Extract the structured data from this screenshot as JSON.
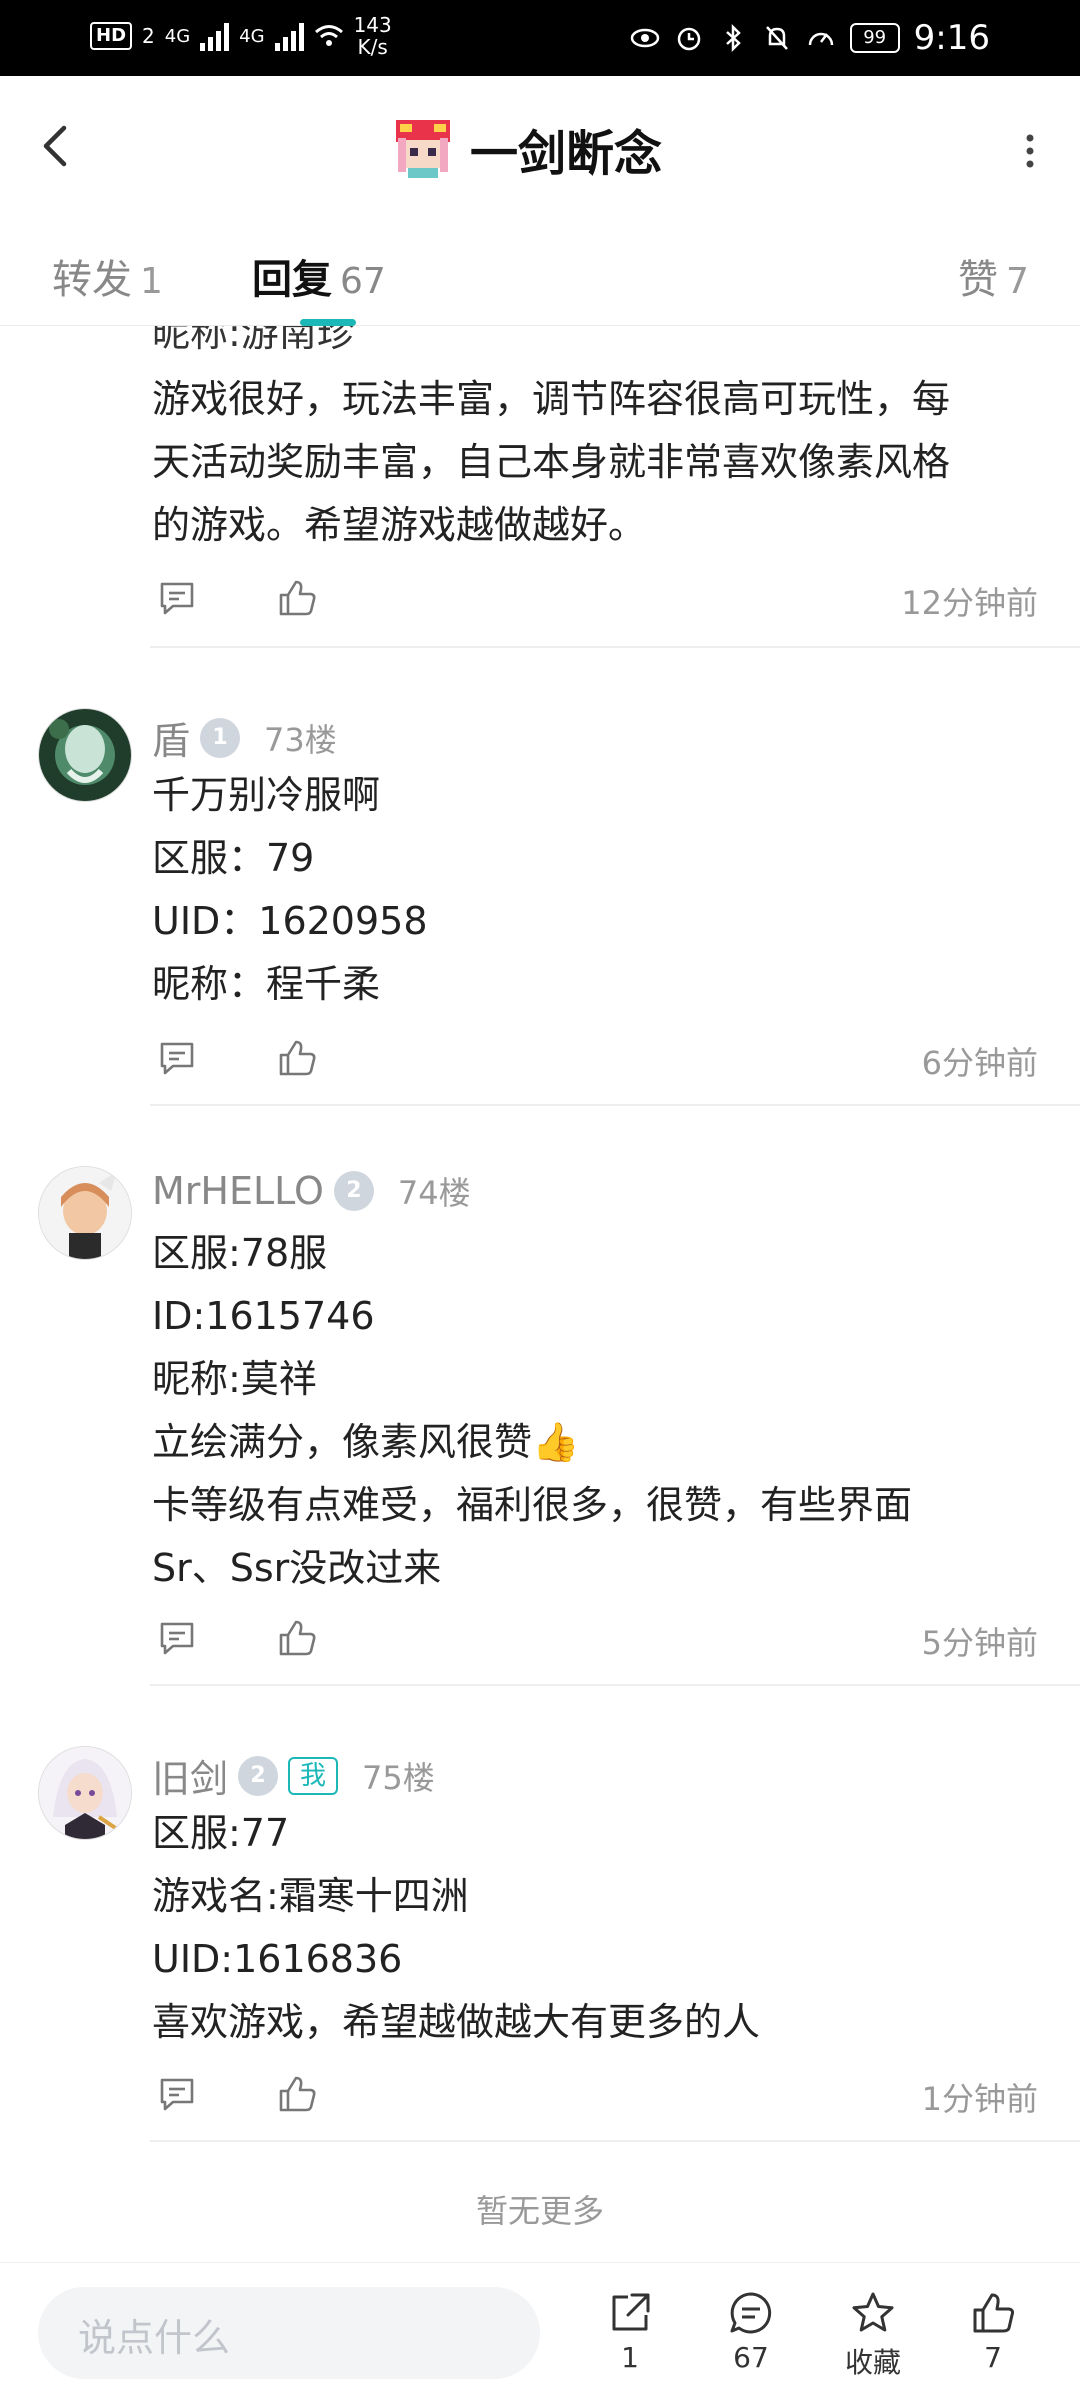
{
  "status": {
    "hd_label": "HD",
    "sim_label": "2",
    "net1": "4G",
    "net2": "4G",
    "speed_value": "143",
    "speed_unit": "K/s",
    "battery": "99",
    "time": "9:16"
  },
  "header": {
    "title": "一剑断念"
  },
  "tabs": [
    {
      "label": "转发",
      "count": "1"
    },
    {
      "label": "回复",
      "count": "67"
    },
    {
      "label": "赞",
      "count": "7"
    }
  ],
  "partial_post": {
    "cut_line": "昵称:游南珍",
    "text": "游戏很好，玩法丰富，调节阵容很高可玩性，每\n天活动奖励丰富，自己本身就非常喜欢像素风格\n的游戏。希望游戏越做越好。",
    "time": "12分钟前"
  },
  "replies": [
    {
      "name": "盾",
      "level": "1",
      "floor": "73楼",
      "text": "千万别冷服啊\n区服：79\nUID：1620958\n昵称：程千柔",
      "time": "6分钟前"
    },
    {
      "name": "MrHELLO",
      "level": "2",
      "floor": "74楼",
      "text": "区服:78服\nID:1615746\n昵称:莫祥\n立绘满分，像素风很赞👍\n卡等级有点难受，福利很多，很赞，有些界面\nSr、Ssr没改过来",
      "time": "5分钟前"
    },
    {
      "name": "旧剑",
      "level": "2",
      "me_badge": "我",
      "floor": "75楼",
      "text": "区服:77\n游戏名:霜寒十四洲\nUID:1616836\n喜欢游戏，希望越做越大有更多的人",
      "time": "1分钟前"
    }
  ],
  "no_more": "暂无更多",
  "bottom": {
    "placeholder": "说点什么",
    "share_count": "1",
    "comment_count": "67",
    "favorite_label": "收藏",
    "like_count": "7"
  }
}
